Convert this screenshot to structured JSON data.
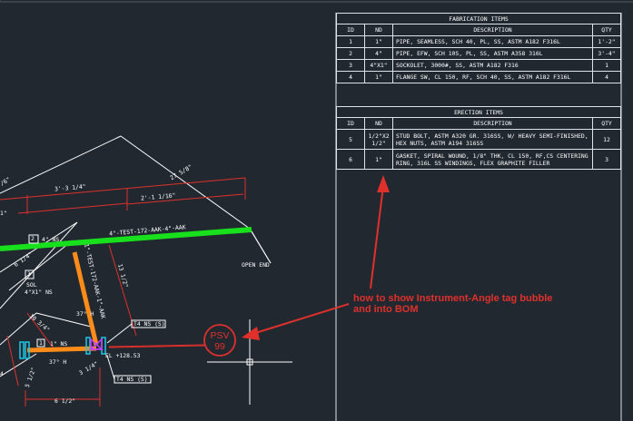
{
  "fabrication": {
    "title": "FABRICATION ITEMS",
    "headers": [
      "ID",
      "ND",
      "DESCRIPTION",
      "QTY"
    ],
    "rows": [
      {
        "id": "1",
        "nd": "1\"",
        "description": "PIPE, SEAMLESS, SCH 40, PL, SS, ASTM A182 F316L",
        "qty": "1'-2\""
      },
      {
        "id": "2",
        "nd": "4\"",
        "description": "PIPE, EFW, SCH 10S, PL, SS, ASTM A358 316L",
        "qty": "3'-4\""
      },
      {
        "id": "3",
        "nd": "4\"X1\"",
        "description": "SOCKOLET, 3000#, SS, ASTM A182 F316",
        "qty": "1"
      },
      {
        "id": "4",
        "nd": "1\"",
        "description": "FLANGE SW, CL 150, RF, SCH 40, SS, ASTM A182 F316L",
        "qty": "4"
      }
    ]
  },
  "erection": {
    "title": "ERECTION ITEMS",
    "headers": [
      "ID",
      "ND",
      "DESCRIPTION",
      "QTY"
    ],
    "rows": [
      {
        "id": "5",
        "nd": "1/2\"X2 1/2\"",
        "description": "STUD BOLT, ASTM A320 GR. 316SS, W/ HEAVY SEMI-FINISHED, HEX NUTS, ASTM A194 316SS",
        "qty": "12"
      },
      {
        "id": "6",
        "nd": "1\"",
        "description": "GASKET, SPIRAL WOUND, 1/8\" THK, CL 150, RF,CS CENTERING RING, 316L SS WINDINGS, FLEX GRAPHITE FILLER",
        "qty": "3"
      }
    ]
  },
  "drawing": {
    "dim_top_left": "3'-3 1/4\"",
    "dim_right": "2'-1 1/16\"",
    "dim_diag": "27 5/8\"",
    "dim_left_cut": "/6\"",
    "dim_left_cut2": "1\"",
    "line_tag_main": "4\"-TEST-172-AAK-4\"-AAK",
    "line_tag_branch": "1\"-TEST-172-AAK-1\"-AAK",
    "open_end": "OPEN END",
    "tag_2": "2",
    "tag_2_text": "4\" NS",
    "tag_3": "3",
    "tag_3_text1": "SOL",
    "tag_3_text2": "4\"X1\" NS",
    "dim_vert": "13 1/2\"",
    "dim_6": "6 1/4\"",
    "angle_37a": "37° H",
    "angle_37b": "37° H",
    "dim_10": "10 3/4\"",
    "tag_1": "1",
    "tag_1_text": "1\" NS",
    "flag_top": "T4 NS (S)",
    "flag_bottom": "T4 NS (S)",
    "elev": "EL +128.53",
    "dim_bottom": "6 1/2\"",
    "dim_bottom_left": "5 1/2\"",
    "dim_small": "3 1/4\"",
    "dim_left_edge": "4"
  },
  "bubble": {
    "line1": "PSV",
    "line2": "99"
  },
  "annotation": {
    "line1": "how to show Instrument-Angle tag bubble",
    "line2": "and into BOM"
  },
  "colors": {
    "background": "#212830",
    "green_pipe": "#19e01c",
    "orange_pipe": "#ff8c1a",
    "dimension_red": "#e0302b",
    "markup_red": "#e0302b",
    "white_lines": "#ffffff",
    "cyan": "#1ec8e8",
    "magenta": "#c040ff"
  }
}
